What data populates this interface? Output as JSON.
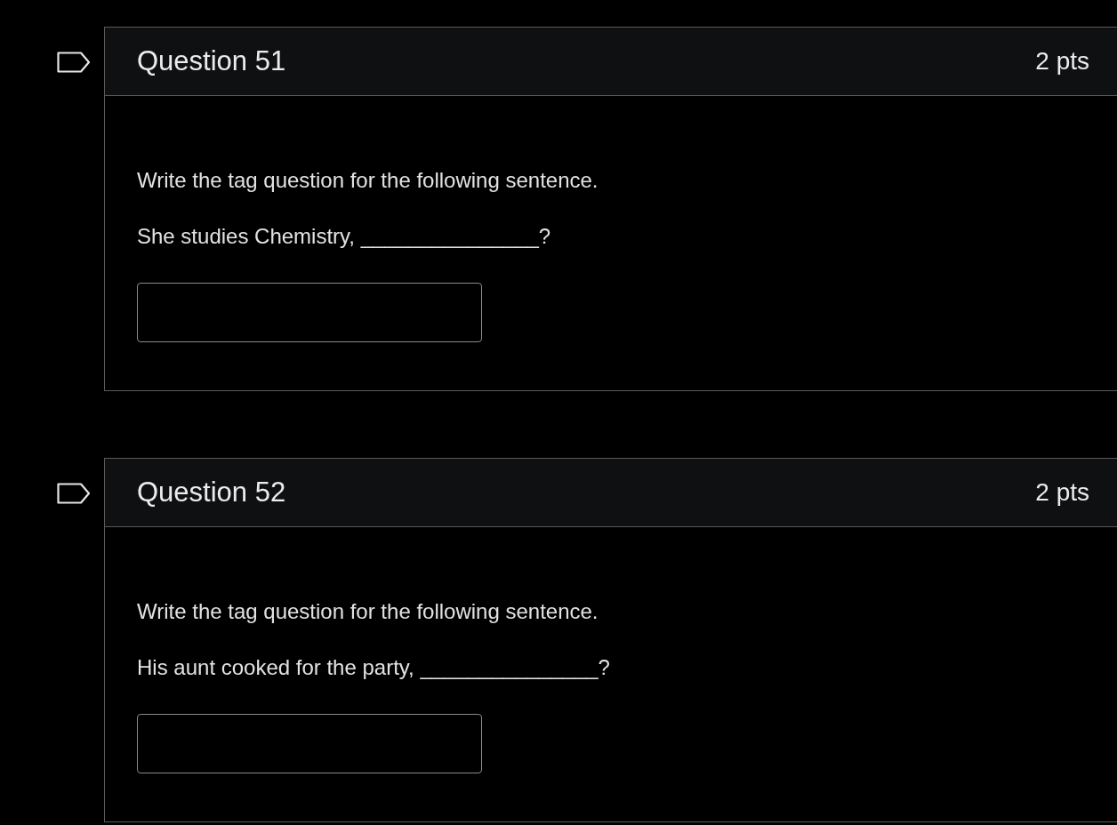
{
  "questions": [
    {
      "title": "Question 51",
      "points": "2 pts",
      "flagged": false,
      "prompt": "Write the tag question for the following sentence.",
      "sentence": "She studies Chemistry, _______________?"
    },
    {
      "title": "Question 52",
      "points": "2 pts",
      "flagged": false,
      "prompt": "Write the tag question for the following sentence.",
      "sentence": "His aunt cooked for the party, _______________?"
    }
  ]
}
